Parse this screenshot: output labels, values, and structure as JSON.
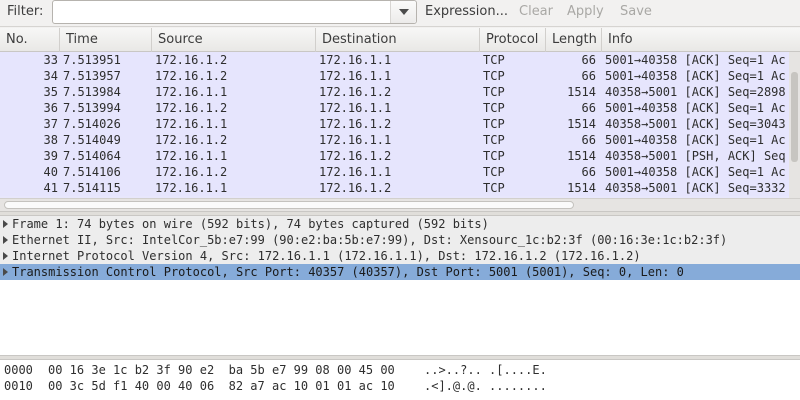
{
  "toolbar": {
    "filter_label": "Filter:",
    "filter_value": "",
    "expression_label": "Expression...",
    "clear_label": "Clear",
    "apply_label": "Apply",
    "save_label": "Save"
  },
  "packet_list": {
    "columns": [
      "No.",
      "Time",
      "Source",
      "Destination",
      "Protocol",
      "Length",
      "Info"
    ],
    "rows": [
      {
        "no": "33",
        "time": "7.513951",
        "src": "172.16.1.2",
        "dst": "172.16.1.1",
        "proto": "TCP",
        "len": "66",
        "info": "5001→40358 [ACK] Seq=1 Ac"
      },
      {
        "no": "34",
        "time": "7.513957",
        "src": "172.16.1.2",
        "dst": "172.16.1.1",
        "proto": "TCP",
        "len": "66",
        "info": "5001→40358 [ACK] Seq=1 Ac"
      },
      {
        "no": "35",
        "time": "7.513984",
        "src": "172.16.1.1",
        "dst": "172.16.1.2",
        "proto": "TCP",
        "len": "1514",
        "info": "40358→5001 [ACK] Seq=2898"
      },
      {
        "no": "36",
        "time": "7.513994",
        "src": "172.16.1.2",
        "dst": "172.16.1.1",
        "proto": "TCP",
        "len": "66",
        "info": "5001→40358 [ACK] Seq=1 Ac"
      },
      {
        "no": "37",
        "time": "7.514026",
        "src": "172.16.1.1",
        "dst": "172.16.1.2",
        "proto": "TCP",
        "len": "1514",
        "info": "40358→5001 [ACK] Seq=3043"
      },
      {
        "no": "38",
        "time": "7.514049",
        "src": "172.16.1.2",
        "dst": "172.16.1.1",
        "proto": "TCP",
        "len": "66",
        "info": "5001→40358 [ACK] Seq=1 Ac"
      },
      {
        "no": "39",
        "time": "7.514064",
        "src": "172.16.1.1",
        "dst": "172.16.1.2",
        "proto": "TCP",
        "len": "1514",
        "info": "40358→5001 [PSH, ACK] Seq"
      },
      {
        "no": "40",
        "time": "7.514106",
        "src": "172.16.1.2",
        "dst": "172.16.1.1",
        "proto": "TCP",
        "len": "66",
        "info": "5001→40358 [ACK] Seq=1 Ac"
      },
      {
        "no": "41",
        "time": "7.514115",
        "src": "172.16.1.1",
        "dst": "172.16.1.2",
        "proto": "TCP",
        "len": "1514",
        "info": "40358→5001 [ACK] Seq=3332"
      }
    ]
  },
  "details": {
    "items": [
      {
        "text": "Frame 1: 74 bytes on wire (592 bits), 74 bytes captured (592 bits)",
        "selected": false
      },
      {
        "text": "Ethernet II, Src: IntelCor_5b:e7:99 (90:e2:ba:5b:e7:99), Dst: Xensourc_1c:b2:3f (00:16:3e:1c:b2:3f)",
        "selected": false
      },
      {
        "text": "Internet Protocol Version 4, Src: 172.16.1.1 (172.16.1.1), Dst: 172.16.1.2 (172.16.1.2)",
        "selected": false
      },
      {
        "text": "Transmission Control Protocol, Src Port: 40357 (40357), Dst Port: 5001 (5001), Seq: 0, Len: 0",
        "selected": true
      }
    ]
  },
  "hex": {
    "rows": [
      {
        "offset": "0000",
        "bytes": "00 16 3e 1c b2 3f 90 e2  ba 5b e7 99 08 00 45 00",
        "ascii": "..>..?.. .[....E."
      },
      {
        "offset": "0010",
        "bytes": "00 3c 5d f1 40 00 40 06  82 a7 ac 10 01 01 ac 10",
        "ascii": ".<].@.@. ........"
      }
    ]
  }
}
